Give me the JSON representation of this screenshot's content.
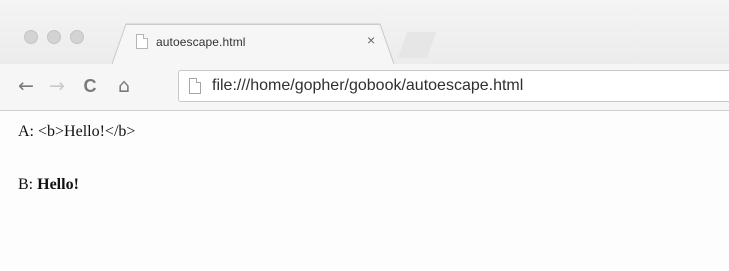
{
  "browser": {
    "tab": {
      "title": "autoescape.html",
      "close_glyph": "×",
      "favicon": "document-icon"
    },
    "toolbar": {
      "back_glyph": "←",
      "forward_glyph": "→",
      "reload_glyph": "C",
      "home_glyph": "⌂",
      "page_icon": "document-icon",
      "url": "file:///home/gopher/gobook/autoescape.html"
    }
  },
  "page": {
    "line_a": {
      "label": "A: ",
      "text": "<b>Hello!</b>"
    },
    "line_b": {
      "label": "B: ",
      "text": "Hello!"
    }
  }
}
